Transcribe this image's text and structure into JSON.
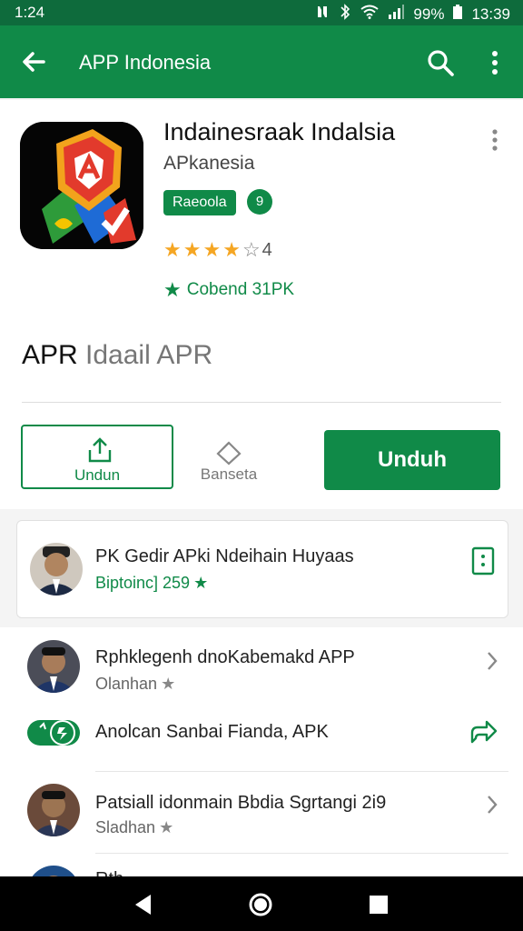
{
  "status": {
    "time_left": "1:24",
    "battery": "99%",
    "clock": "13:39"
  },
  "appbar": {
    "title": "APP Indonesia"
  },
  "app": {
    "title": "Indainesraak Indalsia",
    "developer": "APkanesia",
    "badge": "Raeoola",
    "badge_num": "9",
    "rating": "4",
    "rating_stars": 4,
    "installs": "Cobend 31PK"
  },
  "headline": {
    "main": "APR",
    "rest": "Idaail APR"
  },
  "actions": {
    "share_label": "Undun",
    "fav_label": "Banseta",
    "install_label": "Unduh"
  },
  "featured": {
    "title": "PK Gedir APki Ndeihain Huyaas",
    "sub": "Biptoinc] 259"
  },
  "list": [
    {
      "title": "Rphklegenh dnoKabemakd APP",
      "sub": "Olanhan"
    },
    {
      "title": "Anolcan Sanbai Fianda, APK",
      "sub": ""
    },
    {
      "title": "Patsiall idonmain Bbdia Sgrtangi 2i9",
      "sub": "Sladhan"
    },
    {
      "title": "Rth",
      "sub": ""
    }
  ],
  "colors": {
    "primary": "#108a48",
    "status": "#0e6b3c",
    "star": "#f5a623"
  }
}
